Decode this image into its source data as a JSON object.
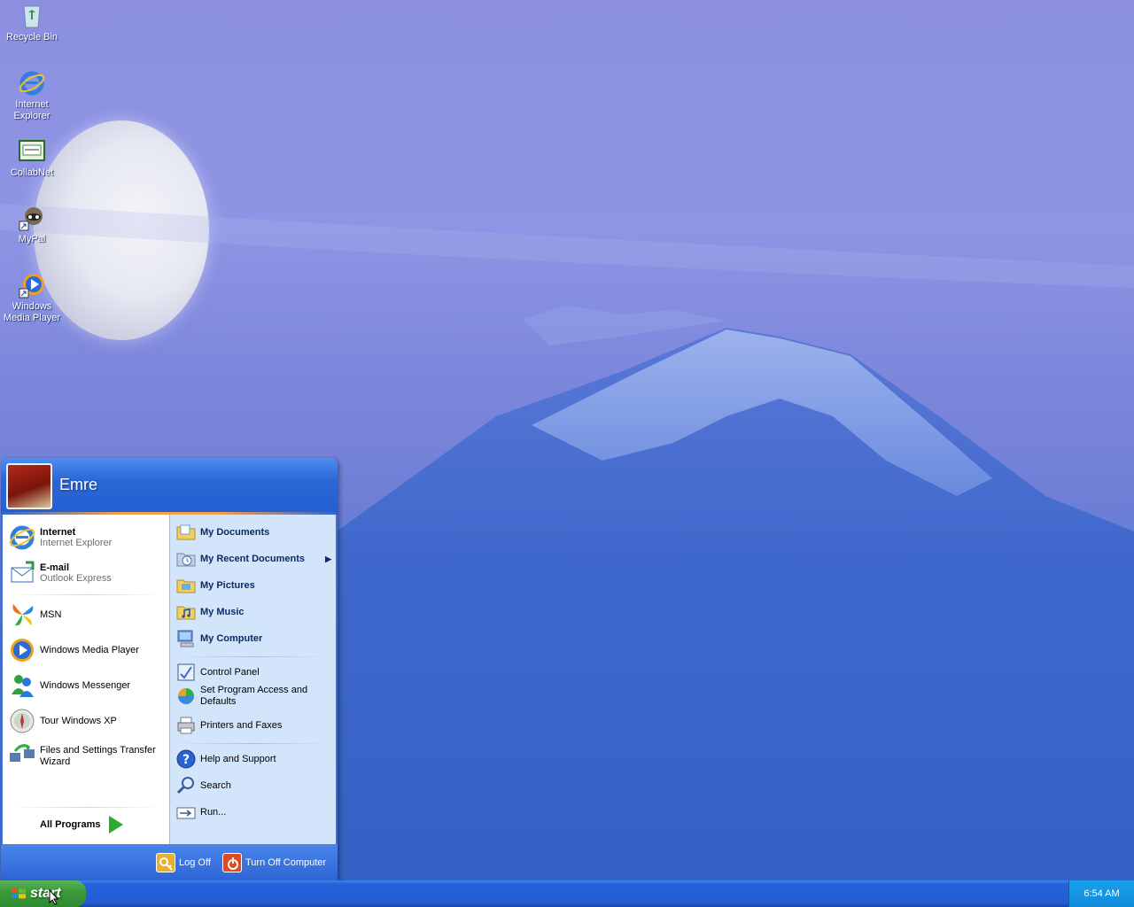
{
  "desktop": {
    "icons": [
      {
        "label": "Recycle Bin",
        "icon": "recycle-bin-icon"
      },
      {
        "label": "Internet Explorer",
        "icon": "internet-explorer-icon"
      },
      {
        "label": "CollabNet",
        "icon": "collabnet-icon"
      },
      {
        "label": "MyPal",
        "icon": "mypal-icon"
      },
      {
        "label": "Windows Media Player",
        "icon": "windows-media-player-icon"
      }
    ]
  },
  "start_menu": {
    "user_name": "Emre",
    "pinned": [
      {
        "title": "Internet",
        "subtitle": "Internet Explorer",
        "icon": "internet-explorer-icon"
      },
      {
        "title": "E-mail",
        "subtitle": "Outlook Express",
        "icon": "outlook-express-icon"
      }
    ],
    "recent": [
      {
        "label": "MSN",
        "icon": "msn-icon"
      },
      {
        "label": "Windows Media Player",
        "icon": "windows-media-player-icon"
      },
      {
        "label": "Windows Messenger",
        "icon": "windows-messenger-icon"
      },
      {
        "label": "Tour Windows XP",
        "icon": "tour-windows-icon"
      },
      {
        "label": "Files and Settings Transfer Wizard",
        "icon": "transfer-wizard-icon"
      }
    ],
    "all_programs": "All Programs",
    "places": [
      {
        "label": "My Documents",
        "icon": "folder-icon"
      },
      {
        "label": "My Recent Documents",
        "icon": "recent-documents-icon"
      },
      {
        "label": "My Pictures",
        "icon": "folder-pictures-icon"
      },
      {
        "label": "My Music",
        "icon": "folder-music-icon"
      },
      {
        "label": "My Computer",
        "icon": "computer-icon"
      }
    ],
    "system": [
      {
        "label": "Control Panel",
        "icon": "control-panel-icon"
      },
      {
        "label": "Set Program Access and Defaults",
        "icon": "program-defaults-icon"
      },
      {
        "label": "Printers and Faxes",
        "icon": "printer-icon"
      }
    ],
    "help": [
      {
        "label": "Help and Support",
        "icon": "help-icon"
      },
      {
        "label": "Search",
        "icon": "search-icon"
      },
      {
        "label": "Run...",
        "icon": "run-icon"
      }
    ],
    "footer": {
      "log_off": "Log Off",
      "turn_off": "Turn Off Computer"
    }
  },
  "taskbar": {
    "start_label": "start",
    "clock": "6:54 AM"
  },
  "colors": {
    "taskbar_blue": "#245dd6",
    "start_green": "#3c9a3c",
    "menu_right_pane": "#d3e5fa",
    "tray_blue": "#0f8ad9"
  }
}
